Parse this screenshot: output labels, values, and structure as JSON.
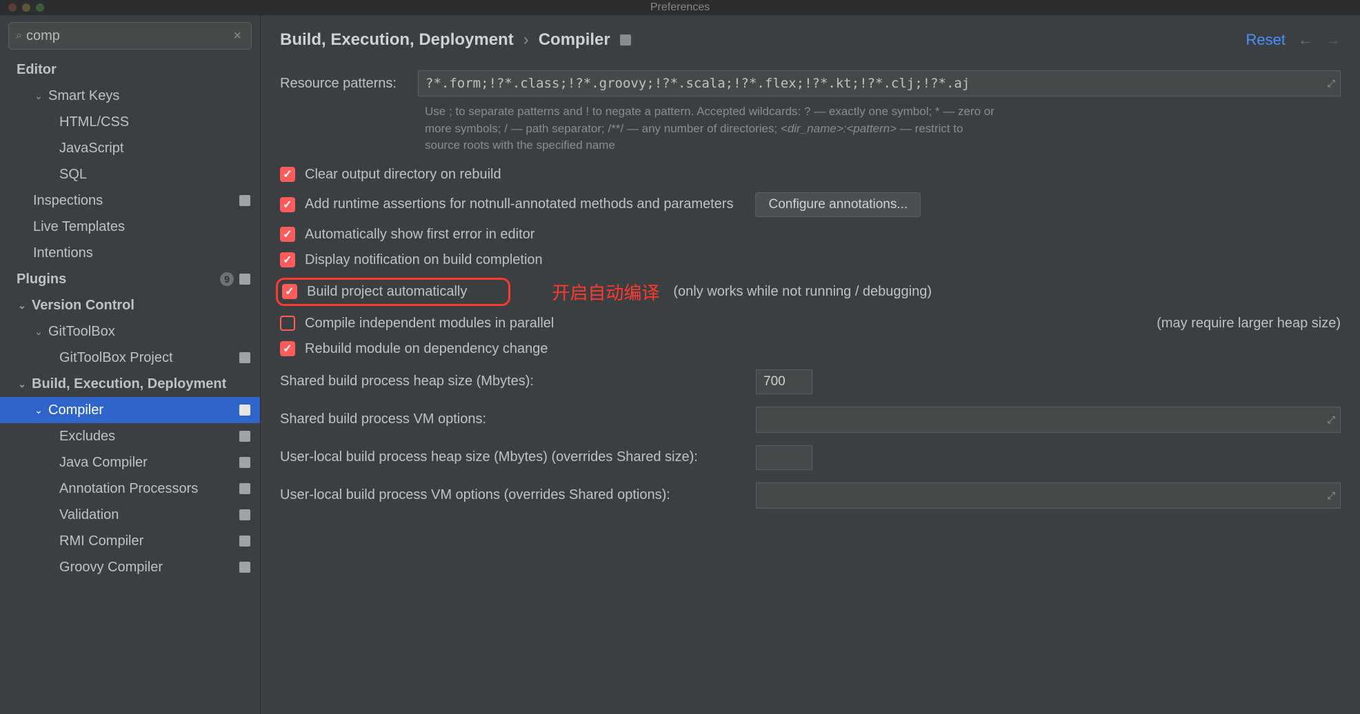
{
  "window": {
    "title": "Preferences"
  },
  "search": {
    "value": "comp"
  },
  "header": {
    "breadcrumb1": "Build, Execution, Deployment",
    "sep": "›",
    "breadcrumb2": "Compiler",
    "reset": "Reset"
  },
  "sidebar": {
    "editor": "Editor",
    "smart_keys": "Smart Keys",
    "html_css": "HTML/CSS",
    "javascript": "JavaScript",
    "sql": "SQL",
    "inspections": "Inspections",
    "live_templates": "Live Templates",
    "intentions": "Intentions",
    "plugins": "Plugins",
    "plugins_badge": "9",
    "version_control": "Version Control",
    "gittoolbox": "GitToolBox",
    "gittoolbox_project": "GitToolBox Project",
    "bed": "Build, Execution, Deployment",
    "compiler": "Compiler",
    "excludes": "Excludes",
    "java_compiler": "Java Compiler",
    "annotation_processors": "Annotation Processors",
    "validation": "Validation",
    "rmi_compiler": "RMI Compiler",
    "groovy_compiler": "Groovy Compiler"
  },
  "form": {
    "resource_patterns_label": "Resource patterns:",
    "resource_patterns_value": "?*.form;!?*.class;!?*.groovy;!?*.scala;!?*.flex;!?*.kt;!?*.clj;!?*.aj",
    "hint_l1": "Use ; to separate patterns and ! to negate a pattern. Accepted wildcards: ? — exactly one symbol; * — zero or",
    "hint_l2a": "more symbols; / — path separator; /**/ — any number of directories; ",
    "hint_l2b": "<dir_name>:<pattern>",
    "hint_l2c": " — restrict to",
    "hint_l3": "source roots with the specified name",
    "cb_clear": "Clear output directory on rebuild",
    "cb_assert": "Add runtime assertions for notnull-annotated methods and parameters",
    "configure_annotations": "Configure annotations...",
    "cb_autoerror": "Automatically show first error in editor",
    "cb_notify": "Display notification on build completion",
    "cb_build_auto": "Build project automatically",
    "cb_build_auto_note": "(only works while not running / debugging)",
    "annotation_cn": "开启自动编译",
    "cb_parallel": "Compile independent modules in parallel",
    "cb_parallel_note": "(may require larger heap size)",
    "cb_rebuild_dep": "Rebuild module on dependency change",
    "shared_heap_label": "Shared build process heap size (Mbytes):",
    "shared_heap_value": "700",
    "shared_vm_label": "Shared build process VM options:",
    "shared_vm_value": "",
    "user_heap_label": "User-local build process heap size (Mbytes) (overrides Shared size):",
    "user_heap_value": "",
    "user_vm_label": "User-local build process VM options (overrides Shared options):",
    "user_vm_value": ""
  }
}
